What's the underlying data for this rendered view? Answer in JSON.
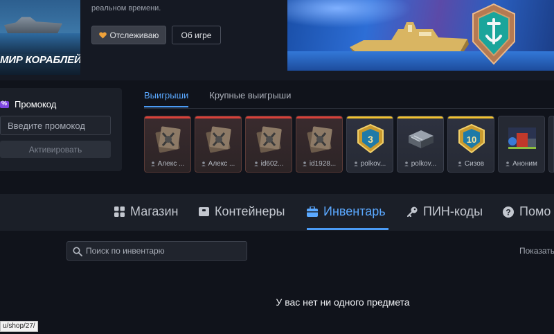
{
  "hero": {
    "game_title": "МИР КОРАБЛЕЙ",
    "description_tail": "реальном времени.",
    "follow_button": "Отслеживаю",
    "about_button": "Об игре"
  },
  "promo": {
    "title": "Промокод",
    "input_placeholder": "Введите промокод",
    "activate_button": "Активировать"
  },
  "wins": {
    "tabs": [
      {
        "label": "Выигрыши",
        "active": true
      },
      {
        "label": "Крупные выигрыши",
        "active": false
      }
    ],
    "cards": [
      {
        "owner": "Алекс ...",
        "rarity": "red",
        "icon": "crate-icon"
      },
      {
        "owner": "Алекс ...",
        "rarity": "red",
        "icon": "crate-icon"
      },
      {
        "owner": "id602...",
        "rarity": "red",
        "icon": "crate-icon"
      },
      {
        "owner": "id1928...",
        "rarity": "red",
        "icon": "crate-icon"
      },
      {
        "owner": "polkov...",
        "rarity": "gold",
        "icon": "medal-3-icon",
        "badge": "3"
      },
      {
        "owner": "polkov...",
        "rarity": "gold",
        "icon": "container-icon"
      },
      {
        "owner": "Сизов",
        "rarity": "gold",
        "icon": "medal-10-icon",
        "badge": "10"
      },
      {
        "owner": "Аноним",
        "rarity": "plain",
        "icon": "bundle-icon"
      }
    ]
  },
  "nav": {
    "items": [
      {
        "label": "Магазин",
        "icon": "grid-icon"
      },
      {
        "label": "Контейнеры",
        "icon": "box-icon"
      },
      {
        "label": "Инвентарь",
        "icon": "briefcase-icon",
        "active": true
      },
      {
        "label": "ПИН-коды",
        "icon": "key-icon"
      },
      {
        "label": "Помо",
        "icon": "help-icon"
      }
    ]
  },
  "inventory": {
    "search_placeholder": "Поиск по инвентарю",
    "show_label": "Показать",
    "empty_message": "У вас нет ни одного предмета"
  },
  "status_bar": {
    "url": "u/shop/27/"
  },
  "colors": {
    "accent": "#4b9bf5",
    "background": "#10131b",
    "panel": "#1b1f28",
    "red_rarity": "#d8403a",
    "gold_rarity": "#f2c230",
    "promo_accent": "#7e46e0"
  }
}
